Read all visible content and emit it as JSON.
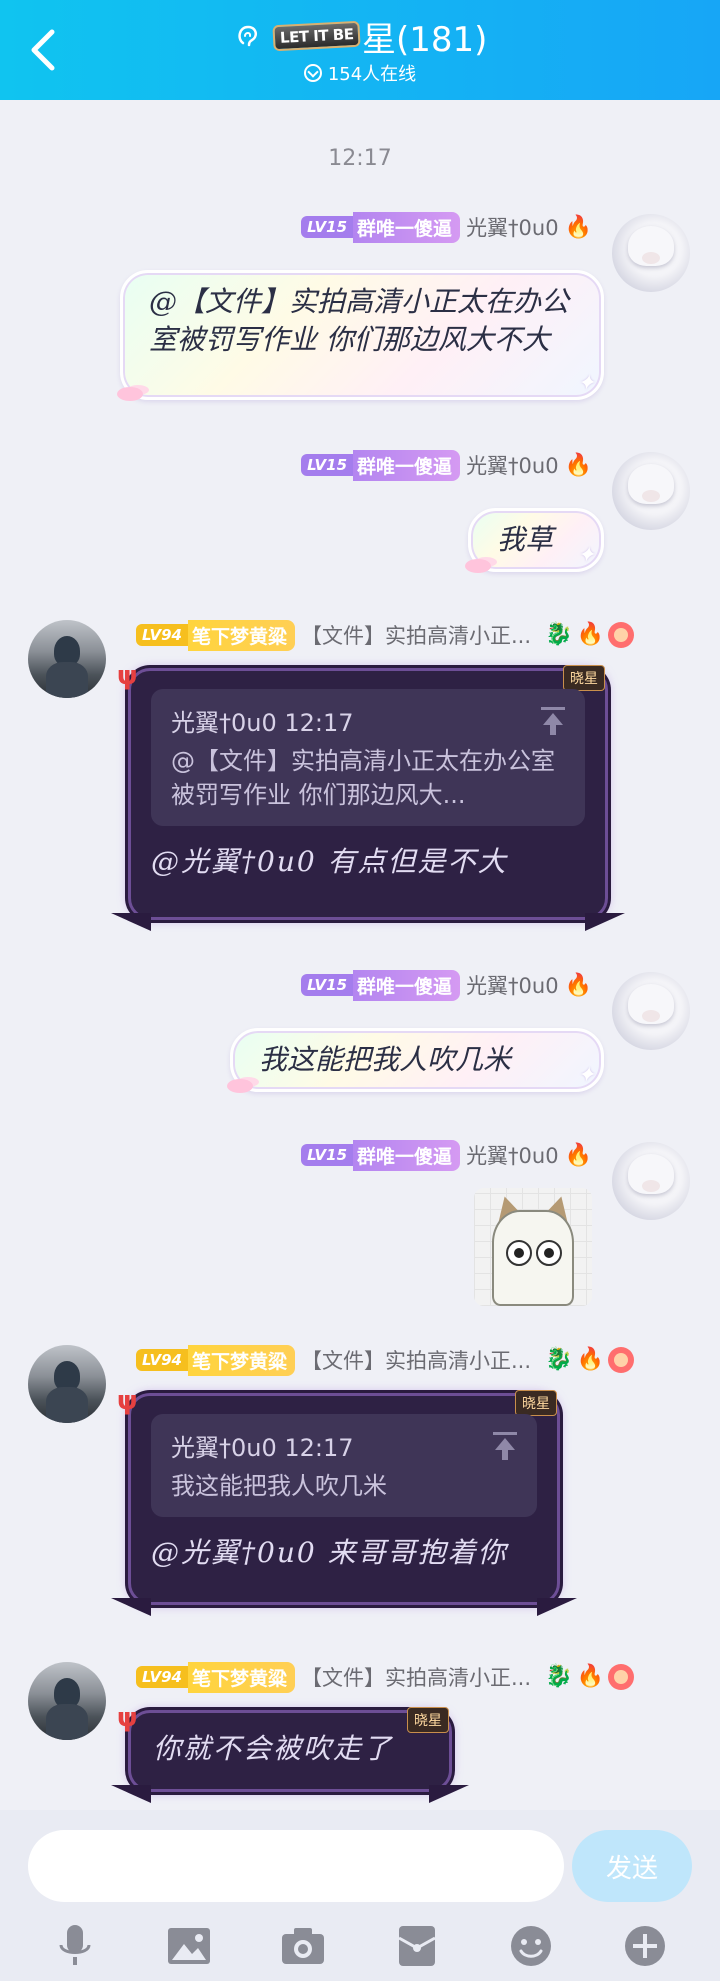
{
  "header": {
    "title": "星(181)",
    "badge": "LET IT BE",
    "online": "154人在线"
  },
  "timestamp": "12:17",
  "self_user": {
    "level": "LV15",
    "title": "群唯一傻逼",
    "nick": "光翼†0u0"
  },
  "other_user": {
    "level": "LV94",
    "title": "笔下梦黄粱",
    "nick": "【文件】实拍高清小正..."
  },
  "messages": [
    {
      "text": "@【文件】实拍高清小正太在办公室被罚写作业 你们那边风大不大"
    },
    {
      "text": "我草"
    },
    {
      "quote_head": "光翼†0u0 12:17",
      "quote_body": "@【文件】实拍高清小正太在办公室被罚写作业 你们那边风大...",
      "reply": "@光翼†0u0 有点但是不大",
      "badge": "晓星"
    },
    {
      "text": "我这能把我人吹几米"
    },
    {
      "sticker": "cat-sticker"
    },
    {
      "quote_head": "光翼†0u0 12:17",
      "quote_body": "我这能把我人吹几米",
      "reply": "@光翼†0u0 来哥哥抱着你",
      "badge": "晓星"
    },
    {
      "text": "你就不会被吹走了",
      "badge": "晓星"
    }
  ],
  "input": {
    "placeholder": "",
    "send_label": "发送"
  },
  "toolbar": [
    "mic-icon",
    "image-icon",
    "camera-icon",
    "redpacket-icon",
    "emoji-icon",
    "plus-icon"
  ],
  "colors": {
    "header": "#17a6f6",
    "send_button": "#bfe6fb",
    "dark_bubble": "#2e2144"
  }
}
